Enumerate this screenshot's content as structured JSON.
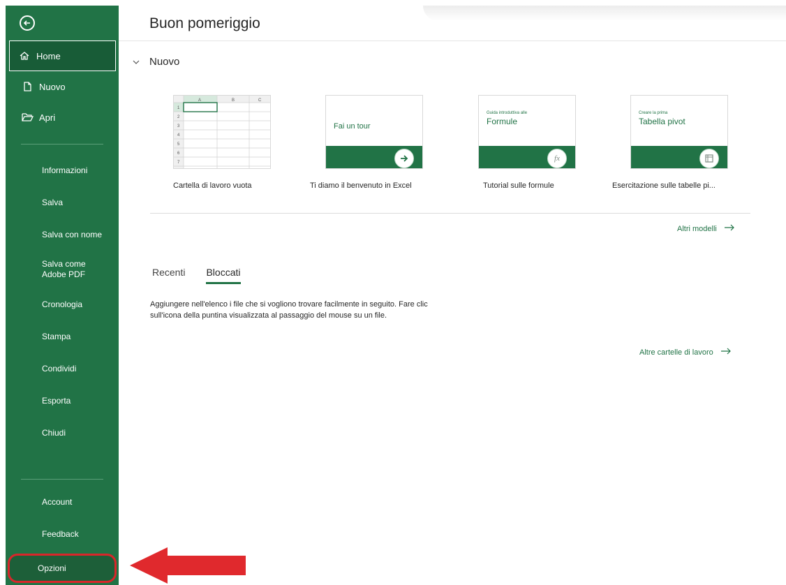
{
  "sidebar": {
    "back_icon": "back-arrow-icon",
    "primary": [
      {
        "label": "Home",
        "icon": "home-icon",
        "active": true
      },
      {
        "label": "Nuovo",
        "icon": "new-file-icon"
      },
      {
        "label": "Apri",
        "icon": "open-folder-icon"
      }
    ],
    "secondary": [
      "Informazioni",
      "Salva",
      "Salva con nome",
      "Salva come Adobe PDF",
      "Cronologia",
      "Stampa",
      "Condividi",
      "Esporta",
      "Chiudi"
    ],
    "bottom": [
      "Account",
      "Feedback"
    ],
    "options_label": "Opzioni"
  },
  "header": {
    "title": "Buon pomeriggio"
  },
  "new_section": {
    "heading": "Nuovo",
    "templates": [
      {
        "label": "Cartella di lavoro vuota"
      },
      {
        "label": "Ti diamo il benvenuto in Excel",
        "card_text": "Fai un tour",
        "icon": "arrow-right-icon"
      },
      {
        "label": "Tutorial sulle formule",
        "card_small": "Guida introduttiva alle",
        "card_big": "Formule",
        "icon": "fx-icon"
      },
      {
        "label": "Esercitazione sulle tabelle pi...",
        "card_small": "Creare la prima",
        "card_big": "Tabella pivot",
        "icon": "pivot-icon"
      }
    ],
    "grid_columns": [
      "A",
      "B",
      "C"
    ],
    "grid_rows": [
      "1",
      "2",
      "3",
      "4",
      "5",
      "6",
      "7"
    ],
    "more_templates": "Altri modelli"
  },
  "files": {
    "tabs": [
      {
        "label": "Recenti"
      },
      {
        "label": "Bloccati",
        "active": true
      }
    ],
    "empty_message": "Aggiungere nell'elenco i file che si vogliono trovare facilmente in seguito. Fare clic sull'icona della puntina visualizzata al passaggio del mouse su un file.",
    "more_workbooks": "Altre cartelle di lavoro"
  },
  "colors": {
    "accent": "#217346",
    "highlight": "#d9262a",
    "arrow": "#e0292d"
  }
}
